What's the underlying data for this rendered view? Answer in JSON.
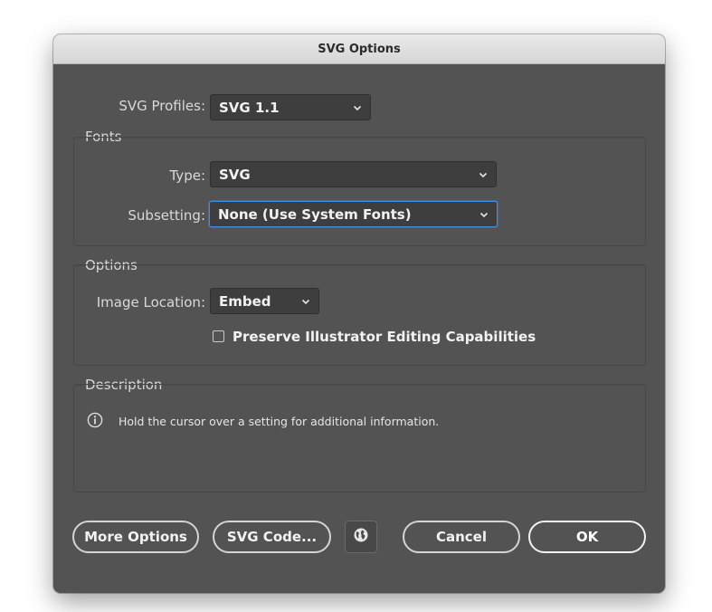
{
  "dialog": {
    "title": "SVG Options",
    "svg_profiles": {
      "label": "SVG Profiles:",
      "value": "SVG 1.1"
    },
    "fonts": {
      "section_title": "Fonts",
      "type": {
        "label": "Type:",
        "value": "SVG"
      },
      "subsetting": {
        "label": "Subsetting:",
        "value": "None (Use System Fonts)"
      }
    },
    "options": {
      "section_title": "Options",
      "image_location": {
        "label": "Image Location:",
        "value": "Embed"
      },
      "preserve_checkbox": {
        "label": "Preserve Illustrator Editing Capabilities",
        "checked": false
      }
    },
    "description": {
      "section_title": "Description",
      "text": "Hold the cursor over a setting for additional information."
    },
    "buttons": {
      "more_options": "More Options",
      "svg_code": "SVG Code...",
      "cancel": "Cancel",
      "ok": "OK"
    },
    "icons": [
      "chevron-down-icon",
      "info-icon",
      "globe-icon"
    ],
    "colors": {
      "panel": "#535353",
      "focus": "#3f8ee8",
      "titlebar": "#dcdcdc"
    }
  }
}
